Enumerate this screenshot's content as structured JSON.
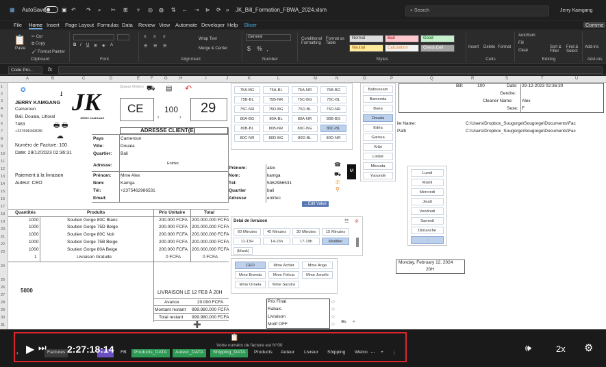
{
  "titlebar": {
    "autosave": "AutoSave",
    "autosave_state": "Off",
    "filename": "JK_Bill_Formation_FBWA_2024.xlsm",
    "search_placeholder": "Search",
    "user": "Jerry Kamgang"
  },
  "menu": [
    "File",
    "Home",
    "Insert",
    "Page Layout",
    "Formulas",
    "Data",
    "Review",
    "View",
    "Automate",
    "Developer",
    "Help",
    "Slicer"
  ],
  "menu_active": "Home",
  "comments_label": "Comme",
  "ribbon": {
    "clipboard": {
      "label": "Clipboard",
      "paste": "Paste",
      "cut": "Cut",
      "copy": "Copy",
      "painter": "Format Painter"
    },
    "font": {
      "label": "Font"
    },
    "alignment": {
      "label": "Alignment",
      "wrap": "Wrap Text",
      "merge": "Merge & Center"
    },
    "number": {
      "label": "Number",
      "format": "General"
    },
    "styles": {
      "label": "Styles",
      "cond": "Conditional Formatting",
      "table": "Format as Table",
      "items": [
        "Normal",
        "Bad",
        "Good",
        "Neutral",
        "Calculation",
        "Check Cell"
      ]
    },
    "cells": {
      "label": "Cells",
      "insert": "Insert",
      "delete": "Delete",
      "format": "Format"
    },
    "editing": {
      "label": "Editing",
      "autosum": "AutoSum",
      "fill": "Fill",
      "clear": "Clear",
      "sort": "Sort & Filter",
      "find": "Find & Select"
    },
    "addins": {
      "label": "Add-ins",
      "item": "Add-ins"
    }
  },
  "formula": {
    "namebox": "Code Pro...",
    "fx": "fx"
  },
  "columns": [
    "A",
    "B",
    "C",
    "D",
    "E",
    "F",
    "G",
    "H",
    "I",
    "J",
    "K",
    "L",
    "M",
    "N",
    "O",
    "P",
    "Q",
    "R",
    "S",
    "T",
    "U"
  ],
  "rows": [
    "1",
    "2",
    "3",
    "4",
    "5",
    "6",
    "7",
    "8",
    "9",
    "10",
    "11",
    "12",
    "13",
    "14",
    "15",
    "16",
    "17",
    "18",
    "19",
    "20",
    "21",
    "22",
    "23",
    "24",
    "25",
    "26",
    "27",
    "28",
    "29",
    "30",
    "31"
  ],
  "company": {
    "name": "JERRY KAMGANG",
    "country": "Cameroun",
    "address": "Bali, Douala, Littoral",
    "postal": "7483",
    "phone": "+237696343036",
    "logo": "JK",
    "logo_sub": "JERRY KAMGANG",
    "queue_label": "Queue Orders"
  },
  "invoice": {
    "number_label": "Numéro de Facture: 100",
    "date_label": "Date: 29/12/2023   02:36:31",
    "payment": "Paiement à la livraison",
    "author": "Auteur: CEO",
    "code": "CE",
    "num": "100",
    "day": "29"
  },
  "client": {
    "header": "ADRESSE CLIENT(E)",
    "pays_label": "Pays",
    "pays": "Cameroun",
    "ville_label": "Ville:",
    "ville": "Douala",
    "quartier_label": "Quartier:",
    "quartier": "Bali",
    "adresse_label": "Adresse:",
    "adresse": "Entrtec",
    "prenom_label": "Prénom:",
    "prenom": "Mme Alex",
    "nom_label": "Nom:",
    "nom": "Kamga",
    "tel_label": "Tél:",
    "tel": "+2375462986531",
    "email_label": "Email:",
    "email": ""
  },
  "client2": {
    "prenom_label": "Prénom:",
    "prenom": "alex",
    "nom_label": "Nom:",
    "nom": "kamga",
    "tel_label": "Tél:",
    "tel": "5462986531",
    "quartier_label": "Quartier",
    "quartier": "bali",
    "adresse_label": "Adresse",
    "adresse": "entrtec",
    "edit_button": "←Edit Value",
    "m_button": "M"
  },
  "table": {
    "headers": [
      "Quantités",
      "Produits",
      "Prix Unitaire",
      "Total"
    ],
    "rows": [
      {
        "q": "1000",
        "p": "Soutien Gorge 80C Blanc",
        "u": "200.000 FCFA",
        "t": "200.000.000 FCFA"
      },
      {
        "q": "1000",
        "p": "Soutien Gorge 75D Beige",
        "u": "200.000 FCFA",
        "t": "200.000.000 FCFA"
      },
      {
        "q": "1000",
        "p": "Soutien Gorge 80C Noir",
        "u": "200.000 FCFA",
        "t": "200.000.000 FCFA"
      },
      {
        "q": "1000",
        "p": "Soutien Gorge 75B Beige",
        "u": "200.000 FCFA",
        "t": "200.000.000 FCFA"
      },
      {
        "q": "1000",
        "p": "Soutien Gorge 80A Beige",
        "u": "200.000 FCFA",
        "t": "200.000.000 FCFA"
      },
      {
        "q": "1",
        "p": "Livraison Gratuite",
        "u": "0 FCFA",
        "t": "0 FCFA"
      }
    ],
    "big_total": "5000",
    "livraison_title": "LIVRAISON  LE 12 FEB À 20H",
    "avance_label": "Avance",
    "avance": "20.000 FCFA",
    "montant_label": "Montant restant",
    "montant": "999.980.000 FCFA",
    "total_label": "Total restant",
    "total": "999.980.000 FCFA"
  },
  "summary": [
    "Prix Final",
    "Rabais",
    "Livraison",
    "Motif OFF"
  ],
  "footer_note": "Votre numéro de facture est N°00",
  "sizes": [
    [
      "75A-BG",
      "75A-BL",
      "75A-NR",
      "75B-BG"
    ],
    [
      "75B-BL",
      "75B-NR",
      "75C-BG",
      "75C-BL"
    ],
    [
      "75C-NR",
      "75D-BG",
      "75D-BL",
      "75D-NR"
    ],
    [
      "80A-BG",
      "80A-BL",
      "80A-NR",
      "80B-BG"
    ],
    [
      "80B-BL",
      "80B-NR",
      "80C-BG",
      "80C-BL"
    ],
    [
      "80C-NR",
      "80D-BG",
      "80D-BL",
      "80D-NR"
    ]
  ],
  "sizes_selected": "80C-BL",
  "cities": [
    "Bafoussam",
    "Bamenda",
    "Buea",
    "Douala",
    "Edéa",
    "Garoua",
    "Kribi",
    "Limbé",
    "Mbouda",
    "Yaoundé"
  ],
  "cities_selected": "Douala",
  "days": [
    "Lundi",
    "Mardi",
    "Mercredi",
    "Jeudi",
    "Vendredi",
    "Samedi",
    "Dimanche",
    "-"
  ],
  "days_selected": "-",
  "bill_panel": {
    "bill_label": "Bill:",
    "bill": "100",
    "date_label": "Date:",
    "date": "29-12-2023   02:36:30",
    "genre_label": "Gendre:",
    "genre": "",
    "cleaner_label": "Cleaner Name:",
    "cleaner": "Alex",
    "sexe_label": "Sexe:",
    "sexe": "F"
  },
  "paths": {
    "file_label": "ile Name:",
    "file": "C:\\Users\\Dropbox_Sougorge\\Sougorge\\Documents\\Fac",
    "path_label": "Path",
    "path": "C:\\Users\\Dropbox_Sougorge\\Sougorge\\Documents\\Fac"
  },
  "delivery_date": "Monday, February 12, 2024",
  "delivery_time": "20H",
  "delai_slicer": {
    "title": "Delai de livraison",
    "items": [
      "60 Minutes",
      "45 Minutes",
      "30 Minutes",
      "15 Minutes",
      "11-13H",
      "14-16h",
      "17-19h",
      "Modifier",
      "(blank)"
    ],
    "selected": "Modifier"
  },
  "author_slicer": {
    "items": [
      "CEO",
      "Mme Achlet",
      "Mme Ange",
      "Mme Brenda",
      "Mme Felicia",
      "Mme Jonelle",
      "Mme Ornela",
      "Mme Sandra"
    ],
    "selected": "CEO"
  },
  "sheet_tabs": [
    "Factures",
    "",
    "FB",
    "Products_DATA",
    "Auteur_DATA",
    "Shipping_DATA",
    "Products",
    "Auteur",
    "Livreur",
    "Shipping",
    "Welco"
  ],
  "video": {
    "time": "2:27:18:14",
    "speed": "2x"
  }
}
